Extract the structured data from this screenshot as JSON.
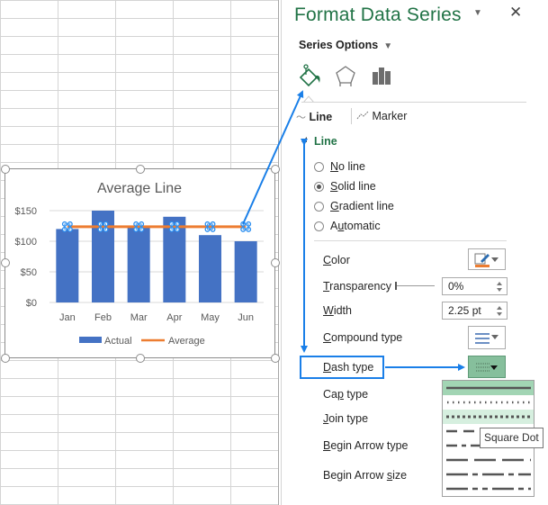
{
  "pane": {
    "title": "Format Data Series",
    "options_menu_icon": "dropdown-caret-icon",
    "close_icon": "close-icon",
    "series_options_label": "Series Options",
    "icon_tabs": [
      "fill-line-icon",
      "effects-pentagon-icon",
      "series-options-bar-icon"
    ],
    "sub_tabs": [
      {
        "icon": "line-icon",
        "label": "Line",
        "active": true
      },
      {
        "icon": "marker-icon",
        "label": "Marker",
        "active": false
      }
    ],
    "section_title": "Line",
    "line_options": [
      {
        "label": "No line",
        "accel": "N",
        "rest": "o line",
        "selected": false
      },
      {
        "label": "Solid line",
        "accel": "S",
        "rest": "olid line",
        "selected": true
      },
      {
        "label": "Gradient line",
        "accel": "G",
        "rest": "radient line",
        "selected": false
      },
      {
        "label": "Automatic",
        "accel_pre": "A",
        "accel": "u",
        "rest": "tomatic",
        "selected": false
      }
    ],
    "properties": {
      "color": {
        "label": "Color",
        "accel": "C",
        "rest": "olor",
        "value_color": "#ED7D31"
      },
      "transparency": {
        "label": "Transparency",
        "accel": "T",
        "rest": "ransparency",
        "value": "0%"
      },
      "width": {
        "label": "Width",
        "accel": "W",
        "rest": "idth",
        "value": "2.25 pt"
      },
      "compound_type": {
        "label": "Compound type",
        "accel": "C",
        "rest": "ompound type"
      },
      "dash_type": {
        "label": "Dash type",
        "accel": "D",
        "rest": "ash type"
      },
      "cap_type": {
        "label": "Cap type",
        "pre": "Ca",
        "accel": "p",
        "rest": " type"
      },
      "join_type": {
        "label": "Join type",
        "accel": "J",
        "rest": "oin type"
      },
      "begin_arrow_type": {
        "label": "Begin Arrow type",
        "accel": "B",
        "rest": "egin Arrow type"
      },
      "begin_arrow_size": {
        "label": "Begin Arrow size",
        "pre": "Begin Arrow ",
        "accel": "s",
        "rest": "ize"
      }
    },
    "dash_menu": {
      "items": [
        "Solid",
        "Round Dot",
        "Square Dot",
        "Dash",
        "Dash Dot",
        "Long Dash",
        "Long Dash Dot",
        "Long Dash Dot Dot"
      ],
      "selected": "Solid",
      "hovered": "Square Dot",
      "tooltip": "Square Dot"
    }
  },
  "chart_data": {
    "type": "bar",
    "title": "Average Line",
    "categories": [
      "Jan",
      "Feb",
      "Mar",
      "Apr",
      "May",
      "Jun"
    ],
    "series": [
      {
        "name": "Actual",
        "type": "bar",
        "color": "#4472C4",
        "values": [
          120,
          150,
          122,
          140,
          110,
          100
        ]
      },
      {
        "name": "Average",
        "type": "line",
        "color": "#ED7D31",
        "values": [
          123.7,
          123.7,
          123.7,
          123.7,
          123.7,
          123.7
        ]
      }
    ],
    "y_ticks": [
      "$0",
      "$50",
      "$100",
      "$150"
    ],
    "y_tick_values": [
      0,
      50,
      100,
      150
    ],
    "ylim": [
      0,
      150
    ],
    "xlabel": "",
    "ylabel": "",
    "grid": true,
    "legend": "bottom",
    "selected_series": "Average"
  },
  "annotation_color": "#1A7FE8"
}
